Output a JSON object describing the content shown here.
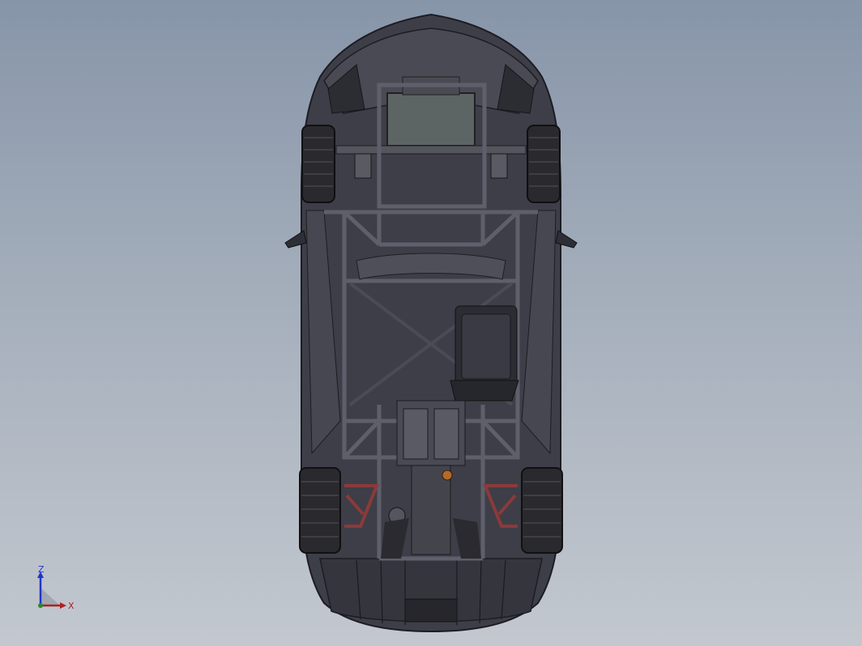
{
  "view": {
    "subject": "top-view-car-chassis-model",
    "colors": {
      "background_top": "#8795a9",
      "background_bottom": "#c3c8cf",
      "body": "#3e3e48",
      "body_edge": "#1c1c22",
      "frame": "#5a5d68",
      "tire": "#2a2a2e",
      "suspension_accent": "#8b3a3a"
    }
  },
  "triad": {
    "z_label": "Z",
    "x_label": "X",
    "z_color": "#2236c8",
    "x_color": "#b22020"
  }
}
